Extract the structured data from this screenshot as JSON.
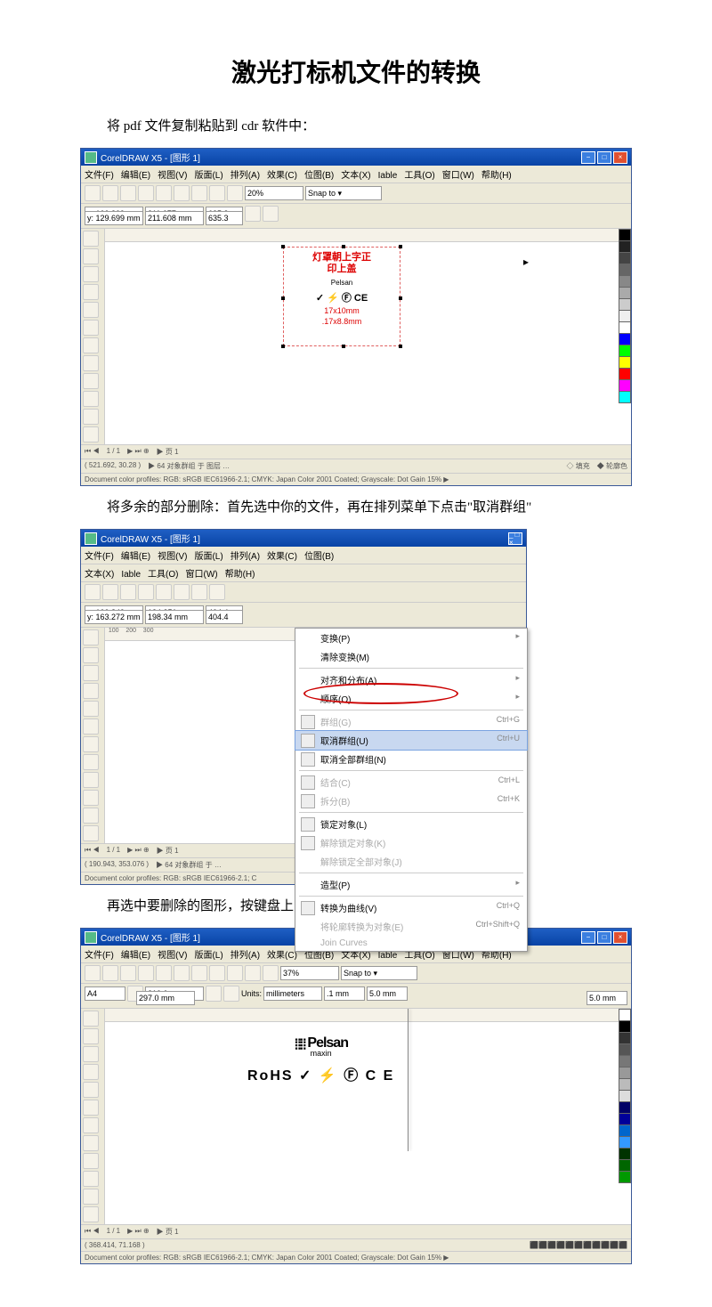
{
  "title": "激光打标机文件的转换",
  "p1": "将 pdf 文件复制粘贴到 cdr 软件中：",
  "p2": "将多余的部分删除：首先选中你的文件，再在排列菜单下点击\"取消群组\"",
  "p3": "再选中要删除的图形，按键盘上的 Delete 键一点一点删除",
  "app": {
    "winTitle": "CorelDRAW X5 - [图形 1]",
    "menus": [
      "文件(F)",
      "编辑(E)",
      "视图(V)",
      "版面(L)",
      "排列(A)",
      "效果(C)",
      "位图(B)",
      "文本(X)",
      "Iable",
      "工具(O)",
      "窗口(W)",
      "帮助(H)"
    ],
    "menus2": [
      "文件(F)",
      "编辑(E)",
      "视图(V)",
      "版面(L)",
      "排列(A)",
      "效果(C)",
      "位图(B)"
    ],
    "menus2b": [
      "文本(X)",
      "Iable",
      "工具(O)",
      "窗口(W)",
      "帮助(H)"
    ],
    "zoom1": "20%",
    "zoom3": "37%",
    "snap": "Snap to ▾",
    "coord1": {
      "x": "x: 100.309 mm",
      "y": "y: 129.699 mm",
      "w": "211.077 mm",
      "h": "211.608 mm",
      "sx": "635.3",
      "sy": "635.3"
    },
    "coord2": {
      "x": "x: 100.849 mm",
      "y": "y: 163.272 mm",
      "w": "134.351 mm",
      "h": "198.34 mm",
      "sx": "404.4",
      "sy": "404.4"
    },
    "paper3": "A4",
    "paper3w": "210.0 mm",
    "paper3h": "297.0 mm",
    "units": "millimeters",
    "nudge": ".1 mm",
    "pgw": "5.0 mm",
    "pgh": "5.0 mm",
    "art1_l1": "灯罩朝上字正",
    "art1_l2": "印上盖",
    "art1_brand": "Pelsan",
    "art1_ce": "CE",
    "art1_sz": "17x10mm",
    "art1_sz2": ".17x8.8mm",
    "art3_brand": "Pelsan",
    "art3_sub": "maxin",
    "art3_marks": "RoHS ✓ ⚡ Ⓕ C E",
    "pager": "1 / 1",
    "pgtab": "▶ 页 1",
    "status1a": "( 521.692, 30.28 )",
    "status1b": "▶ 64 对象群组 于 图层 …",
    "status1c": "填充",
    "status1d": "轮廓色",
    "colorprof": "Document color profiles: RGB: sRGB IEC61966-2.1; CMYK: Japan Color 2001 Coated; Grayscale: Dot Gain 15% ▶",
    "status2a": "( 190.943, 353.076 )",
    "status2b": "▶ 64 对象群组 于 …",
    "colorprof2": "Document color profiles: RGB: sRGB IEC61966-2.1; C",
    "status3a": "( 368.414, 71.168 )",
    "dd": [
      {
        "t": "变换(P)",
        "arr": true
      },
      {
        "t": "清除变换(M)"
      },
      {
        "sep": true
      },
      {
        "t": "对齐和分布(A)",
        "arr": true
      },
      {
        "t": "顺序(O)",
        "arr": true
      },
      {
        "sep": true
      },
      {
        "t": "群组(G)",
        "sc": "Ctrl+G",
        "dis": true,
        "ico": true
      },
      {
        "t": "取消群组(U)",
        "sc": "Ctrl+U",
        "hl": true,
        "ico": true
      },
      {
        "t": "取消全部群组(N)",
        "ico": true
      },
      {
        "sep": true
      },
      {
        "t": "结合(C)",
        "sc": "Ctrl+L",
        "dis": true,
        "ico": true
      },
      {
        "t": "拆分(B)",
        "sc": "Ctrl+K",
        "dis": true,
        "ico": true
      },
      {
        "sep": true
      },
      {
        "t": "锁定对象(L)",
        "ico": true
      },
      {
        "t": "解除锁定对象(K)",
        "dis": true,
        "ico": true
      },
      {
        "t": "解除锁定全部对象(J)",
        "dis": true
      },
      {
        "sep": true
      },
      {
        "t": "造型(P)",
        "arr": true
      },
      {
        "sep": true
      },
      {
        "t": "转换为曲线(V)",
        "sc": "Ctrl+Q",
        "ico": true
      },
      {
        "t": "将轮廓转换为对象(E)",
        "sc": "Ctrl+Shift+Q",
        "dis": true
      },
      {
        "t": "Join Curves",
        "dis": true
      }
    ]
  },
  "palette": [
    "#000",
    "#222",
    "#444",
    "#666",
    "#888",
    "#aaa",
    "#ccc",
    "#eee",
    "#fff",
    "#00f",
    "#0f0",
    "#ff0",
    "#f00",
    "#f0f",
    "#0ff"
  ],
  "palette3": [
    "#fff",
    "#000",
    "#333",
    "#555",
    "#777",
    "#999",
    "#bbb",
    "#ddd",
    "#006",
    "#009",
    "#06c",
    "#39f",
    "#030",
    "#060",
    "#090"
  ]
}
